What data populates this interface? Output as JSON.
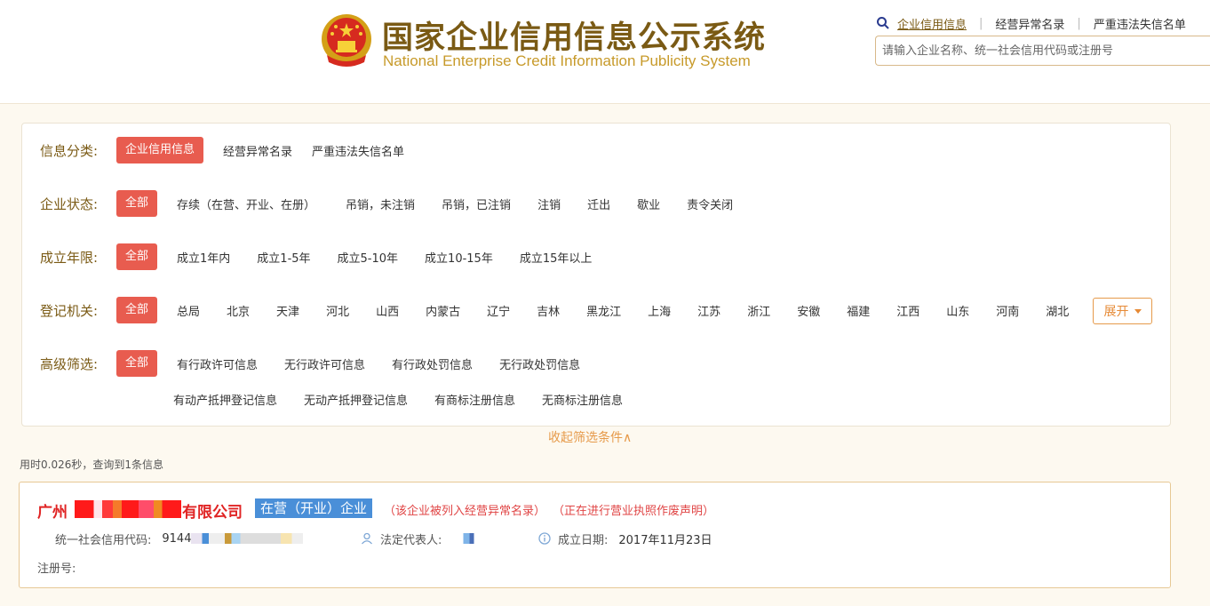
{
  "header": {
    "title": "国家企业信用信息公示系统",
    "subtitle": "National Enterprise Credit Information Publicity System",
    "emblem_icon": "national-emblem-icon"
  },
  "topnav": {
    "items": [
      {
        "label": "企业信用信息",
        "active": true
      },
      {
        "label": "经营异常名录",
        "active": false
      },
      {
        "label": "严重违法失信名单",
        "active": false
      }
    ],
    "search_placeholder": "请输入企业名称、统一社会信用代码或注册号"
  },
  "filters": {
    "category": {
      "label": "信息分类:",
      "options": [
        "企业信用信息",
        "经营异常名录",
        "严重违法失信名单"
      ],
      "selected": "企业信用信息"
    },
    "status": {
      "label": "企业状态:",
      "options": [
        "全部",
        "存续（在营、开业、在册）",
        "吊销，未注销",
        "吊销，已注销",
        "注销",
        "迁出",
        "歇业",
        "责令关闭"
      ],
      "selected": "全部"
    },
    "age": {
      "label": "成立年限:",
      "options": [
        "全部",
        "成立1年内",
        "成立1-5年",
        "成立5-10年",
        "成立10-15年",
        "成立15年以上"
      ],
      "selected": "全部"
    },
    "authority": {
      "label": "登记机关:",
      "options": [
        "全部",
        "总局",
        "北京",
        "天津",
        "河北",
        "山西",
        "内蒙古",
        "辽宁",
        "吉林",
        "黑龙江",
        "上海",
        "江苏",
        "浙江",
        "安徽",
        "福建",
        "江西",
        "山东",
        "河南",
        "湖北"
      ],
      "selected": "全部",
      "expand_label": "展开"
    },
    "advanced": {
      "label": "高级筛选:",
      "options_row1": [
        "全部",
        "有行政许可信息",
        "无行政许可信息",
        "有行政处罚信息",
        "无行政处罚信息"
      ],
      "options_row2": [
        "有动产抵押登记信息",
        "无动产抵押登记信息",
        "有商标注册信息",
        "无商标注册信息"
      ],
      "selected": "全部"
    },
    "collapse_label": "收起筛选条件∧"
  },
  "result_meta": "用时0.026秒，查询到1条信息",
  "result": {
    "name_prefix": "广州",
    "name_suffix": "有限公司",
    "status": "在营（开业）企业",
    "notice1": "（该企业被列入经营异常名录）",
    "notice2": "（正在进行营业执照作废声明）",
    "credit_code_label": "统一社会信用代码:",
    "credit_code_value": "9144",
    "legal_rep_label": "法定代表人:",
    "founded_label": "成立日期:",
    "founded_value": "2017年11月23日",
    "reg_no_label": "注册号:"
  },
  "colors": {
    "brand_brown": "#7a5a14",
    "accent_red": "#e85c4f",
    "status_blue": "#4a8fd8",
    "orange": "#e69a4a"
  }
}
